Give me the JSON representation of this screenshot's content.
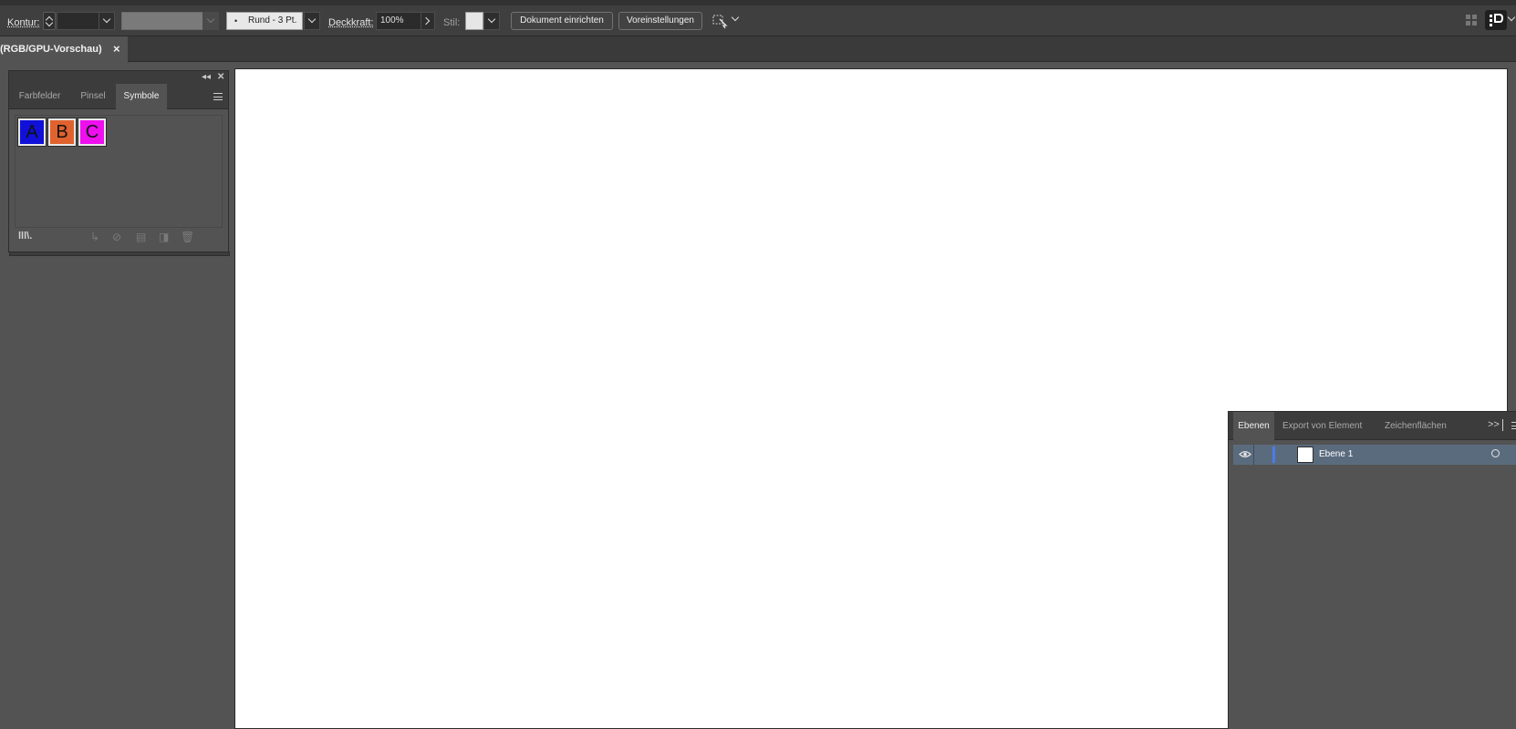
{
  "control_bar": {
    "kontur_label": "Kontur:",
    "brush_label": "Rund - 3 Pt.",
    "deckkraft_label": "Deckkraft:",
    "deckkraft_value": "100%",
    "stil_label": "Stil:",
    "doc_setup_button": "Dokument einrichten",
    "preferences_button": "Voreinstellungen"
  },
  "document": {
    "tab_title": "(RGB/GPU-Vorschau)",
    "close_glyph": "×"
  },
  "symbols_panel": {
    "tabs": [
      "Farbfelder",
      "Pinsel",
      "Symbole"
    ],
    "active_tab": "Symbole",
    "symbols": [
      {
        "label": "A",
        "color": "#1010d8"
      },
      {
        "label": "B",
        "color": "#e0622e"
      },
      {
        "label": "C",
        "color": "#ee0fee"
      }
    ]
  },
  "layers_panel": {
    "tabs": [
      "Ebenen",
      "Export von Element",
      "Zeichenflächen"
    ],
    "active_tab": "Ebenen",
    "layers": [
      {
        "name": "Ebene 1",
        "highlight_color": "#4a7be8"
      }
    ]
  }
}
